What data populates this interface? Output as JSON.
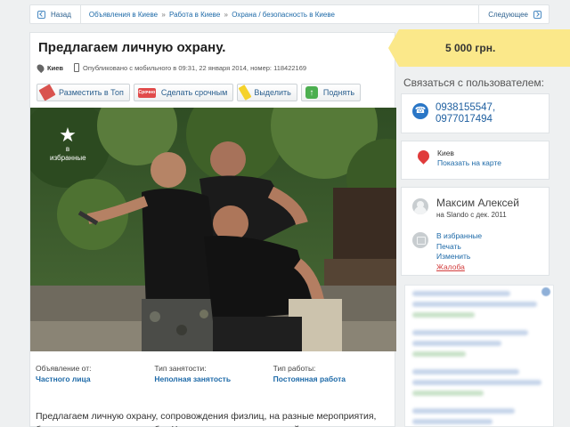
{
  "breadcrumb": {
    "back": "Назад",
    "trail": [
      "Объявления в Киеве",
      "Работа в Киеве",
      "Охрана / безопасность в Киеве"
    ],
    "separator": "»",
    "next": "Следующее"
  },
  "listing": {
    "title": "Предлагаем личную охрану.",
    "city": "Киев",
    "published": "Опубликовано с мобильного в 09:31, 22 января 2014, номер: 118422169"
  },
  "actions": [
    {
      "label": "Разместить в Топ",
      "icon": "top-icon"
    },
    {
      "label": "Сделать срочным",
      "icon": "urgent-icon",
      "badge": "Срочно"
    },
    {
      "label": "Выделить",
      "icon": "highlight-icon"
    },
    {
      "label": "Поднять",
      "icon": "raise-icon"
    }
  ],
  "photo": {
    "favorite": "в избранные"
  },
  "params": [
    {
      "label": "Объявление от:",
      "value": "Частного лица"
    },
    {
      "label": "Тип занятости:",
      "value": "Неполная занятость"
    },
    {
      "label": "Тип работы:",
      "value": "Постоянная работа"
    }
  ],
  "description": "Предлагаем личную охрану, сопровождения физлиц, на разные мероприятия, бары рестораны, диско клубы. Четыри человека спортивной",
  "sidebar": {
    "price": "5 000 грн.",
    "contact_heading": "Связаться с пользователем:",
    "phones": [
      "0938155547,",
      "0977017494"
    ],
    "location": "Киев",
    "show_map": "Показать на карте",
    "user_name": "Максим Алексей",
    "user_since": "на Slando с дек. 2011",
    "links": [
      "В избранные",
      "Печать",
      "Изменить",
      "Жалоба"
    ]
  },
  "colors": {
    "link": "#1e6aa8",
    "price_bg": "#fbe88a",
    "phone_icon": "#2a76c6",
    "pin": "#e03b3b",
    "report": "#d23c3c"
  }
}
